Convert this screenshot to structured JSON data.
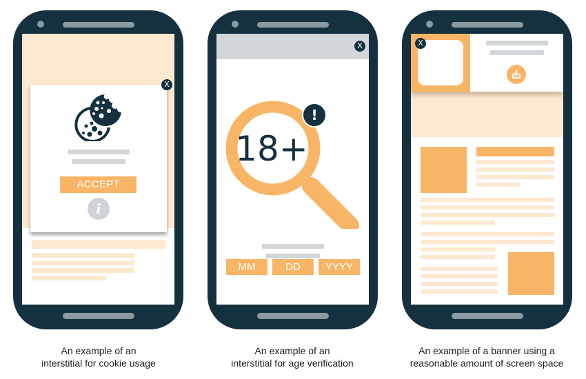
{
  "colors": {
    "phone_body": "#15303e",
    "phone_details": "#8a9aa3",
    "accent_orange": "#f8b565",
    "peach": "#fde8d0",
    "placeholder_gray": "#d3d6d9"
  },
  "phones": [
    {
      "id": "cookie-interstitial",
      "close_label": "X",
      "accept_label": "ACCEPT",
      "info_label": "i",
      "icons": [
        "cookie-icon",
        "info-icon",
        "close-icon"
      ],
      "caption_line1": "An example of an",
      "caption_line2": "interstitial for cookie usage"
    },
    {
      "id": "age-verification-interstitial",
      "close_label": "X",
      "badge_text": "18+",
      "alert_label": "!",
      "date_fields": [
        "MM",
        "DD",
        "YYYY"
      ],
      "icons": [
        "magnifier-icon",
        "alert-icon",
        "close-icon"
      ],
      "caption_line1": "An example of an",
      "caption_line2": "interstitial for age verification"
    },
    {
      "id": "app-install-banner",
      "close_label": "X",
      "icons": [
        "download-icon",
        "close-icon"
      ],
      "caption_line1": "An example of a banner using a",
      "caption_line2": "reasonable amount of screen space"
    }
  ]
}
